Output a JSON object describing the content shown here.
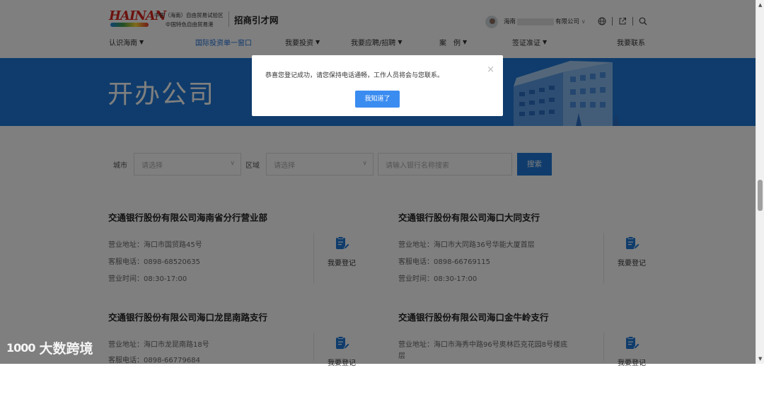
{
  "header": {
    "logo_text": "HAINAN",
    "zone_line1": "中国（海南）自由贸易试验区",
    "zone_line2": "中国特色自由贸易港",
    "site_title": "招商引才网",
    "company_prefix": "海南",
    "company_suffix": "有限公司"
  },
  "nav": {
    "items": [
      {
        "label": "认识海南"
      },
      {
        "label": "国际投资单一窗口"
      },
      {
        "label": "我要投资"
      },
      {
        "label": "我要应聘/招聘"
      },
      {
        "label": "案　例"
      },
      {
        "label": "签证准证"
      },
      {
        "label": "我要联系"
      }
    ]
  },
  "banner": {
    "title": "开办公司"
  },
  "filter": {
    "city_label": "城市",
    "city_placeholder": "请选择",
    "district_label": "区域",
    "district_placeholder": "请选择",
    "search_placeholder": "请输入银行名称搜索",
    "search_button": "搜索"
  },
  "branches": [
    {
      "name": "交通银行股份有限公司海南省分行营业部",
      "address": "营业地址：海口市国贸路45号",
      "phone": "客服电话：0898-68520635",
      "hours": "营业时间：08:30-17:00",
      "action": "我要登记"
    },
    {
      "name": "交通银行股份有限公司海口大同支行",
      "address": "营业地址：海口市大同路36号华能大厦首层",
      "phone": "客服电话：0898-66769115",
      "hours": "营业时间：08:30-17:00",
      "action": "我要登记"
    },
    {
      "name": "交通银行股份有限公司海口龙昆南路支行",
      "address": "营业地址：海口市龙昆南路18号",
      "phone": "客服电话：0898-66779684",
      "action": "我要登记"
    },
    {
      "name": "交通银行股份有限公司海口金牛岭支行",
      "address": "营业地址：海口市海秀中路96号奥林匹克花园8号楼底",
      "address2": "层",
      "action": "我要登记"
    }
  ],
  "modal": {
    "message": "恭喜您登记成功，请您保持电话通畅，工作人员将会与您联系。",
    "confirm_button": "我知道了",
    "close_icon": "×"
  },
  "watermark": {
    "logo": "1000",
    "text": "大数跨境"
  },
  "colors": {
    "accent": "#1e78d8",
    "button": "#3b8cf0"
  }
}
